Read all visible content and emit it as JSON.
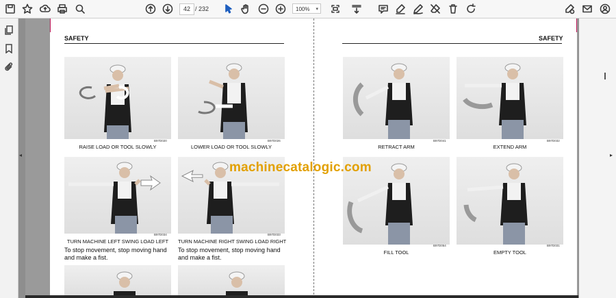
{
  "toolbar": {
    "page_current": "42",
    "page_total": "/ 232",
    "zoom_value": "100%",
    "icons_left": [
      "save-icon",
      "star-icon",
      "upload-icon",
      "print-icon",
      "zoom-search-icon"
    ],
    "icons_mid": [
      "arrow-up-icon",
      "arrow-down-icon",
      "cursor-icon",
      "hand-icon",
      "zoom-out-icon",
      "zoom-in-icon"
    ],
    "icons_right": [
      "fit-page-icon",
      "scroll-mode-icon",
      "comment-icon",
      "highlight-icon",
      "draw-icon",
      "erase-icon",
      "delete-icon",
      "rotate-icon",
      "sign-icon",
      "mail-icon",
      "account-icon"
    ]
  },
  "sidebar": {
    "icons": [
      "pages-icon",
      "bookmark-icon",
      "attachment-icon"
    ]
  },
  "document": {
    "left_header": "SAFETY",
    "right_header": "SAFETY",
    "watermark": "machinecatalogic.com",
    "figures_left": [
      {
        "code": "B97D020",
        "caption": "RAISE LOAD OR TOOL SLOWLY"
      },
      {
        "code": "B97D026",
        "caption": "LOWER LOAD OR TOOL SLOWLY"
      },
      {
        "code": "B97D034",
        "caption": "TURN MACHINE LEFT SWING LOAD LEFT"
      },
      {
        "code": "B97D033",
        "caption": "TURN MACHINE RIGHT SWING LOAD RIGHT"
      }
    ],
    "notes_left": [
      "To stop movement, stop moving hand and make a fist.",
      "To stop movement, stop moving hand and make a fist."
    ],
    "figures_right": [
      {
        "code": "B97D041",
        "caption": "RETRACT ARM"
      },
      {
        "code": "B97D032",
        "caption": "EXTEND ARM"
      },
      {
        "code": "B97D054",
        "caption": "FILL TOOL"
      },
      {
        "code": "B97D031",
        "caption": "EMPTY TOOL"
      }
    ]
  }
}
